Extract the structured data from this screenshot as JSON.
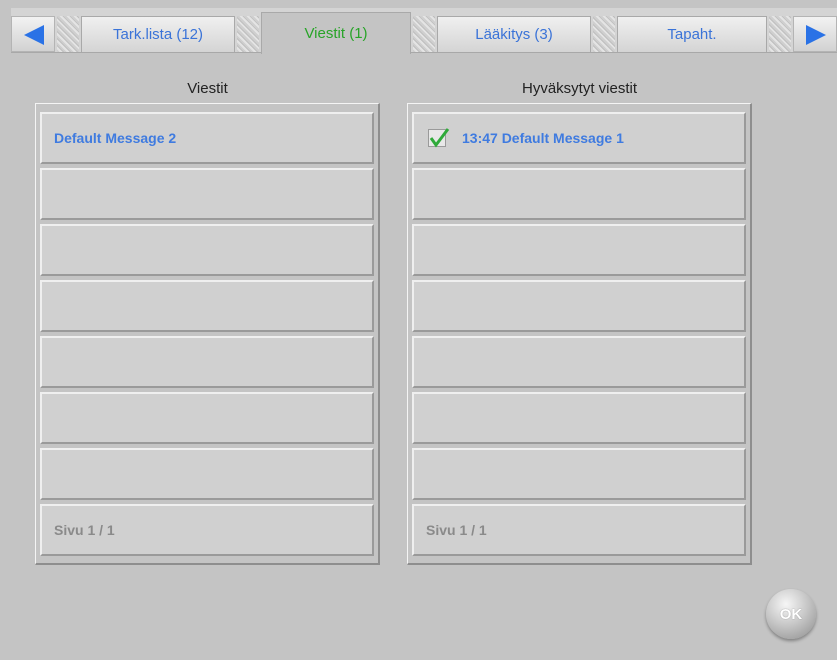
{
  "tabs": [
    {
      "label": "Tark.lista (12)",
      "active": false
    },
    {
      "label": "Viestit (1)",
      "active": true
    },
    {
      "label": "Lääkitys (3)",
      "active": false
    },
    {
      "label": "Tapaht.",
      "active": false
    }
  ],
  "nav": {
    "prev_icon": "left-arrow-icon",
    "next_icon": "right-arrow-icon"
  },
  "messages": {
    "title": "Viestit",
    "items": [
      "Default Message 2",
      "",
      "",
      "",
      "",
      "",
      ""
    ],
    "page": "Sivu 1 / 1"
  },
  "approved": {
    "title": "Hyväksytyt viestit",
    "items": [
      "13:47 Default Message 1",
      "",
      "",
      "",
      "",
      "",
      ""
    ],
    "checked": [
      true
    ],
    "page": "Sivu 1 / 1"
  },
  "ok_label": "OK",
  "colors": {
    "accent": "#3f7be0",
    "active_tab": "#28a428",
    "background": "#c4c4c4"
  }
}
